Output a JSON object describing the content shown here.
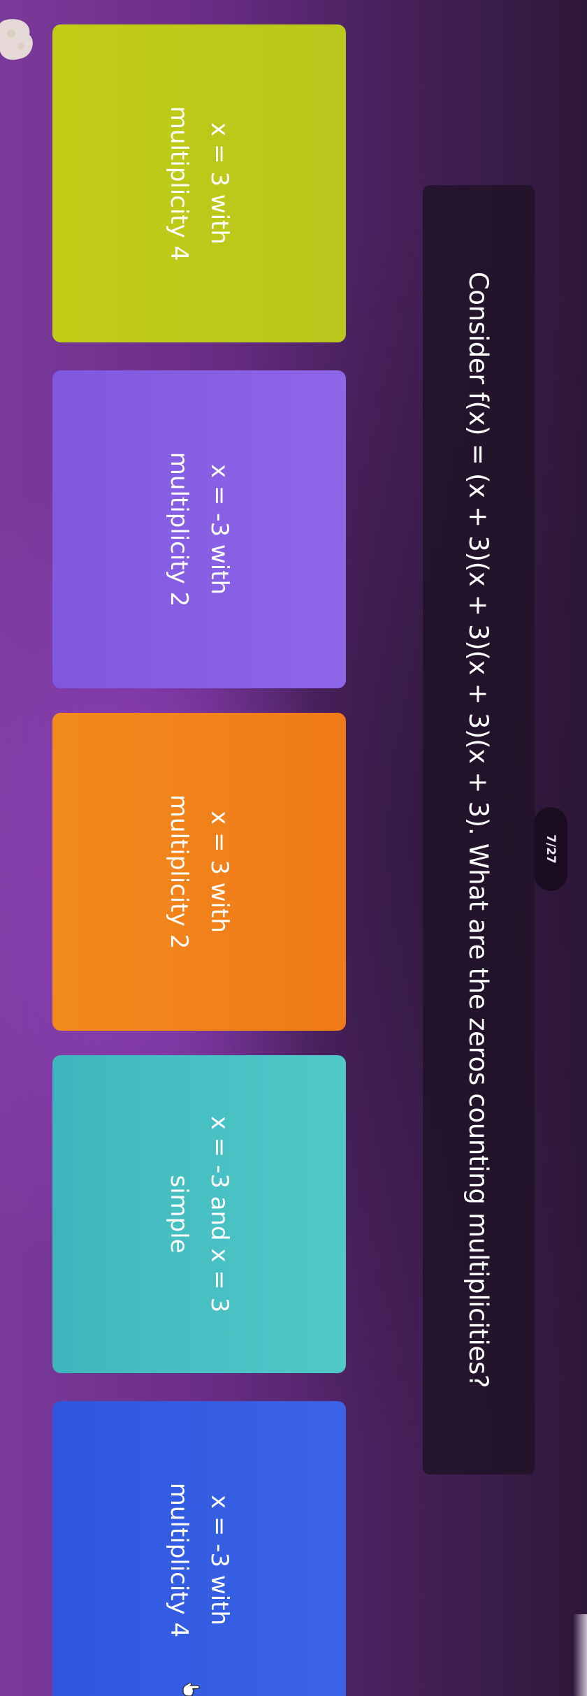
{
  "progress": {
    "label": "7/27"
  },
  "question": {
    "text": "Consider f(x) = (x + 3)(x + 3)(x + 3)(x + 3). What are the zeros counting multiplicities?"
  },
  "answers": [
    {
      "line1": "x = 3 with",
      "line2": "multiplicity 4",
      "color": "#bfc918"
    },
    {
      "line1": "x = -3 with",
      "line2": "multiplicity 2",
      "color": "#865fe4"
    },
    {
      "line1": "x = 3 with",
      "line2": "multiplicity 2",
      "color": "#f2821a"
    },
    {
      "line1": "x = -3 and x = 3",
      "line2": "simple",
      "color": "#48c0c4"
    },
    {
      "line1": "x = -3 with",
      "line2": "multiplicity 4",
      "color": "#355de2"
    }
  ],
  "icons": {
    "cursor": "hand-pointer-icon",
    "decoration": "blob-decoration-icon"
  },
  "colors": {
    "background": "#6a2d86",
    "question_box": "#1e1224"
  }
}
